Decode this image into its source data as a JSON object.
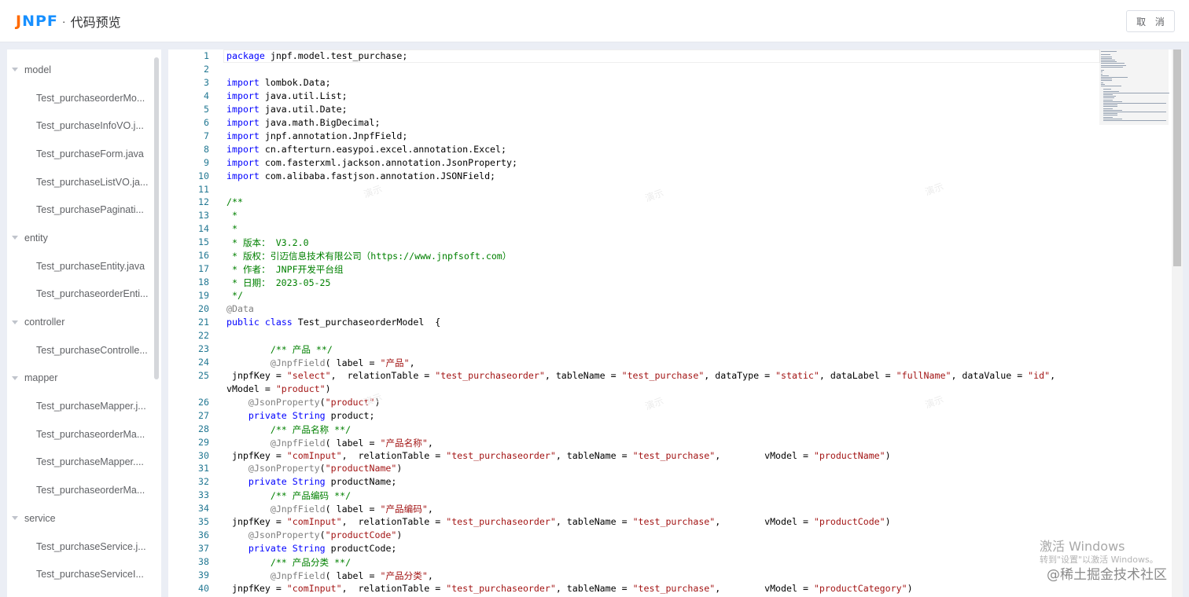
{
  "header": {
    "logo": "JNPF",
    "separator": "·",
    "title": "代码预览",
    "cancel_label": "取 消"
  },
  "sidebar": {
    "folders": [
      {
        "name": "model",
        "files": [
          "Test_purchaseorderMo...",
          "Test_purchaseInfoVO.j...",
          "Test_purchaseForm.java",
          "Test_purchaseListVO.ja...",
          "Test_purchasePaginati..."
        ]
      },
      {
        "name": "entity",
        "files": [
          "Test_purchaseEntity.java",
          "Test_purchaseorderEnti..."
        ]
      },
      {
        "name": "controller",
        "files": [
          "Test_purchaseControlle..."
        ]
      },
      {
        "name": "mapper",
        "files": [
          "Test_purchaseMapper.j...",
          "Test_purchaseorderMa...",
          "Test_purchaseMapper....",
          "Test_purchaseorderMa..."
        ]
      },
      {
        "name": "service",
        "files": [
          "Test_purchaseService.j...",
          "Test_purchaseServiceI..."
        ]
      }
    ]
  },
  "editor": {
    "lines": [
      {
        "n": "1",
        "t": "package jnpf.model.test_purchase;"
      },
      {
        "n": "2",
        "t": ""
      },
      {
        "n": "3",
        "t": "import lombok.Data;"
      },
      {
        "n": "4",
        "t": "import java.util.List;"
      },
      {
        "n": "5",
        "t": "import java.util.Date;"
      },
      {
        "n": "6",
        "t": "import java.math.BigDecimal;"
      },
      {
        "n": "7",
        "t": "import jnpf.annotation.JnpfField;"
      },
      {
        "n": "8",
        "t": "import cn.afterturn.easypoi.excel.annotation.Excel;"
      },
      {
        "n": "9",
        "t": "import com.fasterxml.jackson.annotation.JsonProperty;"
      },
      {
        "n": "10",
        "t": "import com.alibaba.fastjson.annotation.JSONField;"
      },
      {
        "n": "11",
        "t": ""
      },
      {
        "n": "12",
        "t": "/**"
      },
      {
        "n": "13",
        "t": " *"
      },
      {
        "n": "14",
        "t": " *"
      },
      {
        "n": "15",
        "t": " * 版本： V3.2.0"
      },
      {
        "n": "16",
        "t": " * 版权：引迈信息技术有限公司（https://www.jnpfsoft.com）"
      },
      {
        "n": "17",
        "t": " * 作者： JNPF开发平台组"
      },
      {
        "n": "18",
        "t": " * 日期： 2023-05-25"
      },
      {
        "n": "19",
        "t": " */"
      },
      {
        "n": "20",
        "t": "@Data"
      },
      {
        "n": "21",
        "t": "public class Test_purchaseorderModel  {"
      },
      {
        "n": "22",
        "t": ""
      },
      {
        "n": "23",
        "t": "        /** 产品 **/"
      },
      {
        "n": "24",
        "t": "        @JnpfField( label = \"产品\","
      },
      {
        "n": "25",
        "t": " jnpfKey = \"select\",  relationTable = \"test_purchaseorder\", tableName = \"test_purchase\", dataType = \"static\", dataLabel = \"fullName\", dataValue = \"id\","
      },
      {
        "n": "",
        "t": "vModel = \"product\")"
      },
      {
        "n": "26",
        "t": "    @JsonProperty(\"product\")"
      },
      {
        "n": "27",
        "t": "    private String product;"
      },
      {
        "n": "28",
        "t": "        /** 产品名称 **/"
      },
      {
        "n": "29",
        "t": "        @JnpfField( label = \"产品名称\","
      },
      {
        "n": "30",
        "t": " jnpfKey = \"comInput\",  relationTable = \"test_purchaseorder\", tableName = \"test_purchase\",        vModel = \"productName\")"
      },
      {
        "n": "31",
        "t": "    @JsonProperty(\"productName\")"
      },
      {
        "n": "32",
        "t": "    private String productName;"
      },
      {
        "n": "33",
        "t": "        /** 产品编码 **/"
      },
      {
        "n": "34",
        "t": "        @JnpfField( label = \"产品编码\","
      },
      {
        "n": "35",
        "t": " jnpfKey = \"comInput\",  relationTable = \"test_purchaseorder\", tableName = \"test_purchase\",        vModel = \"productCode\")"
      },
      {
        "n": "36",
        "t": "    @JsonProperty(\"productCode\")"
      },
      {
        "n": "37",
        "t": "    private String productCode;"
      },
      {
        "n": "38",
        "t": "        /** 产品分类 **/"
      },
      {
        "n": "39",
        "t": "        @JnpfField( label = \"产品分类\","
      },
      {
        "n": "40",
        "t": " jnpfKey = \"comInput\",  relationTable = \"test_purchaseorder\", tableName = \"test_purchase\",        vModel = \"productCategory\")"
      }
    ],
    "watermark": "演示"
  },
  "overlay": {
    "windows_activate": "激活 Windows",
    "windows_activate_sub": "转到\"设置\"以激活 Windows。",
    "juejin": "@稀土掘金技术社区"
  },
  "colors": {
    "keyword": "#0000ff",
    "string": "#a31515",
    "comment": "#008000",
    "annotation": "#808080",
    "line_number": "#237893",
    "logo_j": "#ff6a00",
    "logo_rest": "#1890ff"
  }
}
